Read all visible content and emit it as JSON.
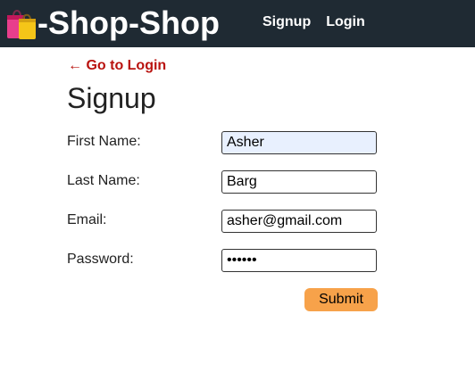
{
  "navbar": {
    "brand_icon": "shopping-bags-icon",
    "brand_text": "-Shop-Shop",
    "links": [
      {
        "label": "Signup"
      },
      {
        "label": "Login"
      }
    ],
    "background": "#1f2a33"
  },
  "main": {
    "back_link": "← Go to Login",
    "back_link_color": "#b9130f",
    "title": "Signup",
    "form": {
      "fields": [
        {
          "label": "First Name:",
          "value": "Asher",
          "type": "text"
        },
        {
          "label": "Last Name:",
          "value": "Barg",
          "type": "text"
        },
        {
          "label": "Email:",
          "value": "asher@gmail.com",
          "type": "email"
        },
        {
          "label": "Password:",
          "value": "••••••",
          "type": "password"
        }
      ],
      "submit_label": "Submit",
      "submit_color": "#f7a24a"
    }
  }
}
